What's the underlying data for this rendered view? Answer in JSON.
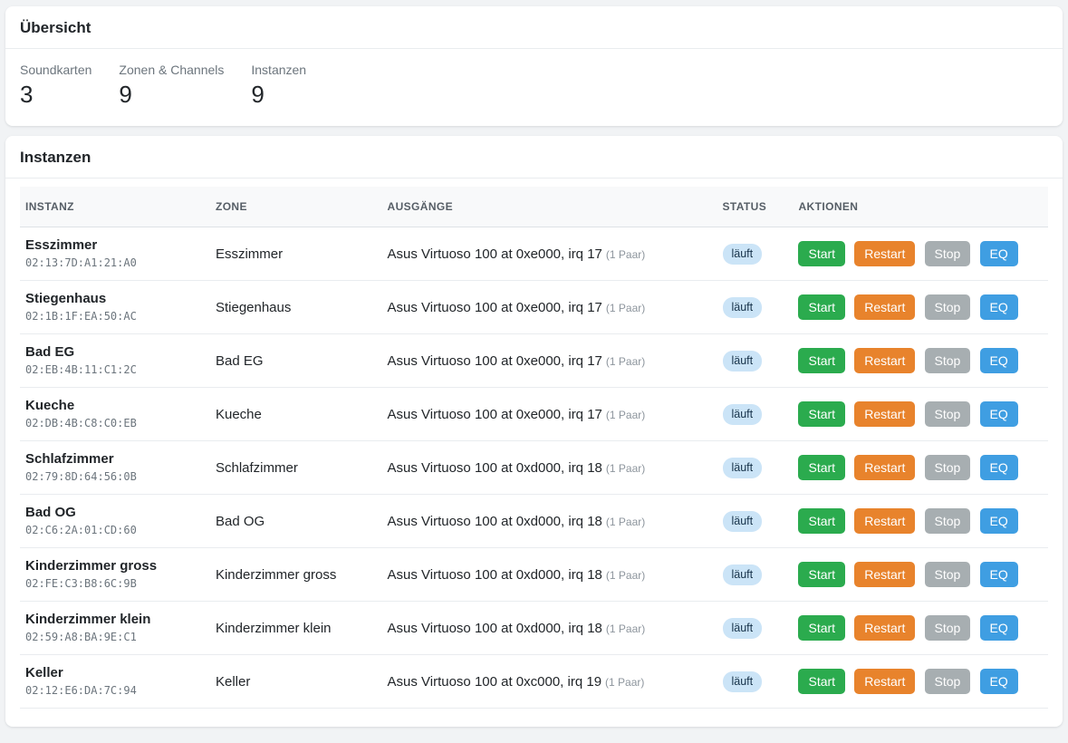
{
  "overview": {
    "title": "Übersicht",
    "stats": [
      {
        "label": "Soundkarten",
        "value": "3"
      },
      {
        "label": "Zonen & Channels",
        "value": "9"
      },
      {
        "label": "Instanzen",
        "value": "9"
      }
    ]
  },
  "instances": {
    "title": "Instanzen",
    "columns": [
      "INSTANZ",
      "ZONE",
      "AUSGÄNGE",
      "STATUS",
      "AKTIONEN"
    ],
    "actions": {
      "start": "Start",
      "restart": "Restart",
      "stop": "Stop",
      "eq": "EQ"
    },
    "rows": [
      {
        "name": "Esszimmer",
        "mac": "02:13:7D:A1:21:A0",
        "zone": "Esszimmer",
        "output": "Asus Virtuoso 100 at 0xe000, irq 17",
        "pairs": "(1 Paar)",
        "status": "läuft"
      },
      {
        "name": "Stiegenhaus",
        "mac": "02:1B:1F:EA:50:AC",
        "zone": "Stiegenhaus",
        "output": "Asus Virtuoso 100 at 0xe000, irq 17",
        "pairs": "(1 Paar)",
        "status": "läuft"
      },
      {
        "name": "Bad EG",
        "mac": "02:EB:4B:11:C1:2C",
        "zone": "Bad EG",
        "output": "Asus Virtuoso 100 at 0xe000, irq 17",
        "pairs": "(1 Paar)",
        "status": "läuft"
      },
      {
        "name": "Kueche",
        "mac": "02:DB:4B:C8:C0:EB",
        "zone": "Kueche",
        "output": "Asus Virtuoso 100 at 0xe000, irq 17",
        "pairs": "(1 Paar)",
        "status": "läuft"
      },
      {
        "name": "Schlafzimmer",
        "mac": "02:79:8D:64:56:0B",
        "zone": "Schlafzimmer",
        "output": "Asus Virtuoso 100 at 0xd000, irq 18",
        "pairs": "(1 Paar)",
        "status": "läuft"
      },
      {
        "name": "Bad OG",
        "mac": "02:C6:2A:01:CD:60",
        "zone": "Bad OG",
        "output": "Asus Virtuoso 100 at 0xd000, irq 18",
        "pairs": "(1 Paar)",
        "status": "läuft"
      },
      {
        "name": "Kinderzimmer gross",
        "mac": "02:FE:C3:B8:6C:9B",
        "zone": "Kinderzimmer gross",
        "output": "Asus Virtuoso 100 at 0xd000, irq 18",
        "pairs": "(1 Paar)",
        "status": "läuft"
      },
      {
        "name": "Kinderzimmer klein",
        "mac": "02:59:A8:BA:9E:C1",
        "zone": "Kinderzimmer klein",
        "output": "Asus Virtuoso 100 at 0xd000, irq 18",
        "pairs": "(1 Paar)",
        "status": "läuft"
      },
      {
        "name": "Keller",
        "mac": "02:12:E6:DA:7C:94",
        "zone": "Keller",
        "output": "Asus Virtuoso 100 at 0xc000, irq 19",
        "pairs": "(1 Paar)",
        "status": "läuft"
      }
    ]
  },
  "colors": {
    "page_background": "#f1f3f5",
    "start_button": "#2bab4e",
    "restart_button": "#e8832c",
    "stop_button": "#a7aeb1",
    "eq_button": "#3f9ee2",
    "status_badge_bg": "#cbe4f7",
    "status_badge_text": "#163249"
  }
}
